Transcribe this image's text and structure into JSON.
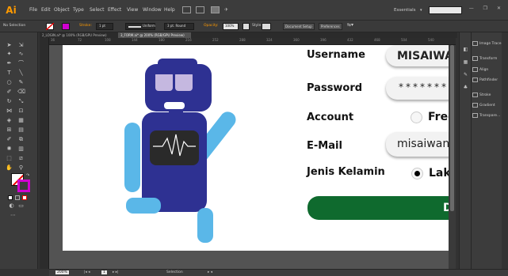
{
  "app": {
    "logo": "Ai",
    "menus": [
      "File",
      "Edit",
      "Object",
      "Type",
      "Select",
      "Effect",
      "View",
      "Window",
      "Help"
    ],
    "workspace": "Essentials",
    "window_buttons": "— ❐ ✕"
  },
  "control_bar": {
    "selection": "No Selection",
    "stroke_label": "Stroke:",
    "stroke_value": "1 pt",
    "profile": "Uniform",
    "brush": "3 pt. Round",
    "opacity_label": "Opacity:",
    "opacity_value": "100%",
    "style_label": "Style:",
    "document_setup": "Document Setup",
    "preferences": "Preferences"
  },
  "tabs": [
    {
      "label": "2_LOGIN.ai* @ 100% (RGB/GPU Preview)",
      "active": false
    },
    {
      "label": "3_FORM.ai* @ 200% (RGB/GPU Preview)",
      "active": true
    }
  ],
  "ruler_ticks": [
    "36",
    "72",
    "108",
    "144",
    "180",
    "216",
    "252",
    "288",
    "324",
    "360",
    "396",
    "432",
    "468",
    "504",
    "540"
  ],
  "panels": [
    {
      "icon": "image-trace-icon",
      "label": "Image Trace"
    },
    {
      "icon": "transform-icon",
      "label": "Transform"
    },
    {
      "icon": "align-icon",
      "label": "Align"
    },
    {
      "icon": "pathfinder-icon",
      "label": "Pathfinder"
    },
    {
      "icon": "stroke-icon",
      "label": "Stroke"
    },
    {
      "icon": "gradient-icon",
      "label": "Gradient"
    },
    {
      "icon": "transparency-icon",
      "label": "Transpare..."
    }
  ],
  "form": {
    "username_label": "Username",
    "username_value": "MISAIWAN",
    "password_label": "Password",
    "password_value": "********",
    "account_label": "Account",
    "account_option": "Free",
    "email_label": "E-Mail",
    "email_value": "misaiwan@",
    "gender_label": "Jenis Kelamin",
    "gender_option": "Laki",
    "submit_label": "D"
  },
  "status_bar": {
    "zoom": "200%",
    "page": "1",
    "tool": "Selection"
  },
  "colors": {
    "robot_body": "#2e3192",
    "robot_visor": "#c5b8e0",
    "robot_limbs": "#5ab7e8",
    "robot_screen": "#2a2a2a",
    "submit_bg": "#0f6a2e",
    "illustrator_orange": "#ff9a00"
  }
}
